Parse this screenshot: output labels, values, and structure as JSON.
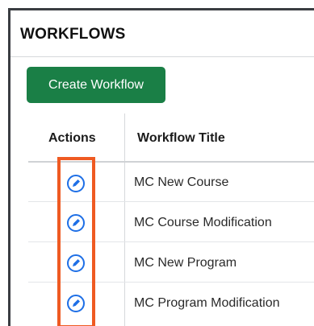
{
  "panel": {
    "title": "WORKFLOWS"
  },
  "toolbar": {
    "create_label": "Create Workflow"
  },
  "table": {
    "columns": [
      "Actions",
      "Workflow Title"
    ],
    "rows": [
      {
        "title": "MC New Course",
        "action_icon": "edit-icon"
      },
      {
        "title": "MC Course Modification",
        "action_icon": "edit-icon"
      },
      {
        "title": "MC New Program",
        "action_icon": "edit-icon"
      },
      {
        "title": "MC Program Modification",
        "action_icon": "edit-icon"
      }
    ]
  },
  "colors": {
    "accent_button": "#1a7f46",
    "edit_icon": "#1e6fe6",
    "highlight_box": "#ef5a22"
  }
}
